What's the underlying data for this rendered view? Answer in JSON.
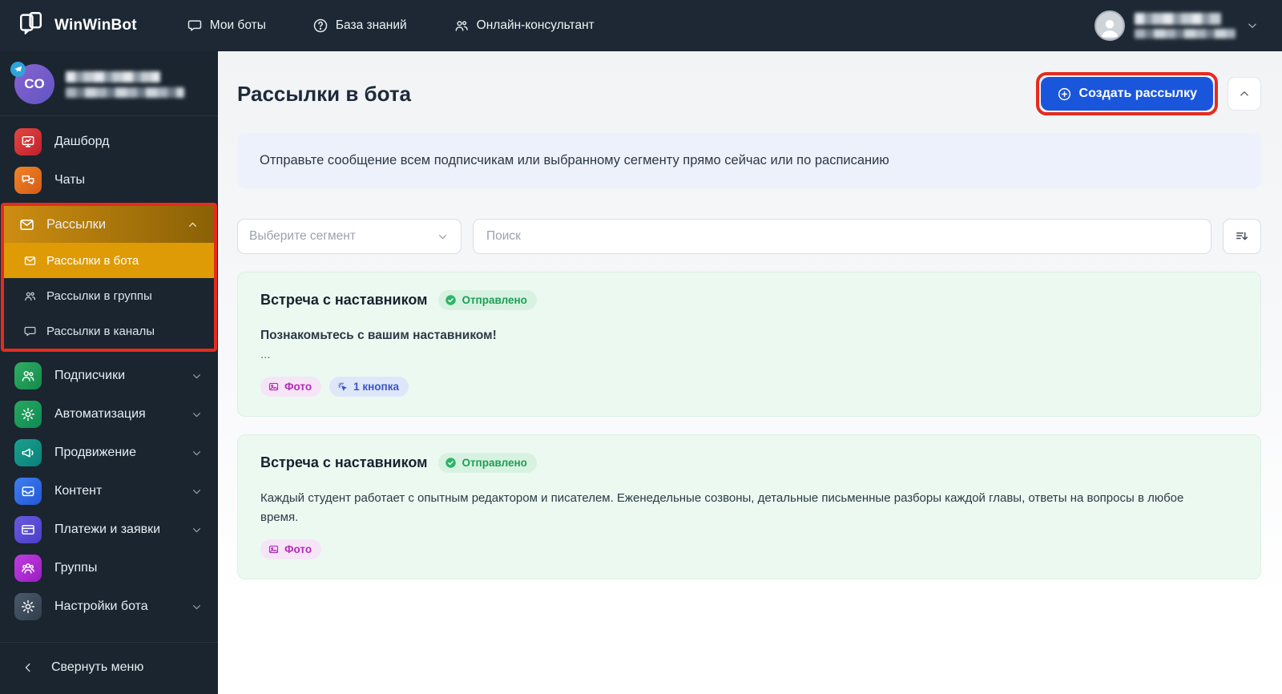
{
  "navbar": {
    "brand": "WinWinBot",
    "items": [
      {
        "id": "my-bots",
        "label": "Мои боты",
        "icon": "chat-bubble-icon"
      },
      {
        "id": "knowledge-base",
        "label": "База знаний",
        "icon": "question-circle-icon"
      },
      {
        "id": "online-consultant",
        "label": "Онлайн-консультант",
        "icon": "people-icon"
      }
    ]
  },
  "sidebar": {
    "account": {
      "initials": "CO"
    },
    "items_top": [
      {
        "id": "dashboard",
        "label": "Дашборд",
        "icon": "dashboard-icon",
        "icon_colors": [
          "#e4483e",
          "#bf1f2f"
        ],
        "chevron": null
      },
      {
        "id": "chats",
        "label": "Чаты",
        "icon": "chats-icon",
        "icon_colors": [
          "#f08427",
          "#d55c17"
        ],
        "chevron": null
      }
    ],
    "broadcasts_group": {
      "parent": {
        "id": "broadcasts",
        "label": "Рассылки",
        "icon": "envelope-icon",
        "chevron": "up"
      },
      "children": [
        {
          "id": "broadcasts-bot",
          "label": "Рассылки в бота",
          "icon": "envelope-icon",
          "active": true
        },
        {
          "id": "broadcasts-groups",
          "label": "Рассылки в группы",
          "icon": "people-icon",
          "active": false
        },
        {
          "id": "broadcasts-channels",
          "label": "Рассылки в каналы",
          "icon": "chat-bubble-icon",
          "active": false
        }
      ]
    },
    "items_bottom": [
      {
        "id": "subscribers",
        "label": "Подписчики",
        "icon": "subscribers-icon",
        "icon_colors": [
          "#2fae63",
          "#148a4c"
        ],
        "chevron": "down"
      },
      {
        "id": "automation",
        "label": "Автоматизация",
        "icon": "gear-icon",
        "icon_colors": [
          "#27a85d",
          "#0f8a56"
        ],
        "chevron": "down"
      },
      {
        "id": "promotion",
        "label": "Продвижение",
        "icon": "megaphone-icon",
        "icon_colors": [
          "#1aa08d",
          "#0b807a"
        ],
        "chevron": "down"
      },
      {
        "id": "content",
        "label": "Контент",
        "icon": "drawer-icon",
        "icon_colors": [
          "#3e7ef0",
          "#2458d6"
        ],
        "chevron": "down"
      },
      {
        "id": "payments",
        "label": "Платежи и заявки",
        "icon": "card-icon",
        "icon_colors": [
          "#6a5ae0",
          "#4a3ec8"
        ],
        "chevron": "down"
      },
      {
        "id": "groups",
        "label": "Группы",
        "icon": "groups-icon",
        "icon_colors": [
          "#c03de0",
          "#9a1ec0"
        ],
        "chevron": null
      },
      {
        "id": "bot-settings",
        "label": "Настройки бота",
        "icon": "gear-icon",
        "icon_colors": [
          "#4a5a6c",
          "#323e4d"
        ],
        "chevron": "down"
      }
    ],
    "collapse_label": "Свернуть меню"
  },
  "main": {
    "title": "Рассылки в бота",
    "create_button_label": "Создать рассылку",
    "banner_text": "Отправьте сообщение всем подписчикам или выбранному сегменту прямо сейчас или по расписанию",
    "segment_select_placeholder": "Выберите сегмент",
    "search_placeholder": "Поиск",
    "cards": [
      {
        "title": "Встреча с наставником",
        "status": "Отправлено",
        "body_lines": [
          {
            "text": "Познакомьтесь с вашим наставником!",
            "bold": true
          },
          {
            "text": "...",
            "bold": false
          }
        ],
        "tags": [
          {
            "label": "Фото",
            "type": "photo",
            "icon": "photo-icon"
          },
          {
            "label": "1 кнопка",
            "type": "button",
            "icon": "click-icon"
          }
        ]
      },
      {
        "title": "Встреча с наставником",
        "status": "Отправлено",
        "body_lines": [
          {
            "text": "Каждый студент работает с опытным редактором и писателем. Еженедельные созвоны, детальные письменные разборы каждой главы, ответы на вопросы в любое время.",
            "bold": false
          }
        ],
        "tags": [
          {
            "label": "Фото",
            "type": "photo",
            "icon": "photo-icon"
          }
        ]
      }
    ]
  },
  "colors": {
    "navbar_bg": "#1d2834",
    "sidebar_bg": "#1a2530",
    "accent_blue": "#1a56db",
    "annotation_red": "#e62b1e",
    "active_amber": "#de9b06",
    "success_green": "#1e9e54",
    "card_bg": "#ecf9f1",
    "banner_bg": "#edf1fb"
  }
}
